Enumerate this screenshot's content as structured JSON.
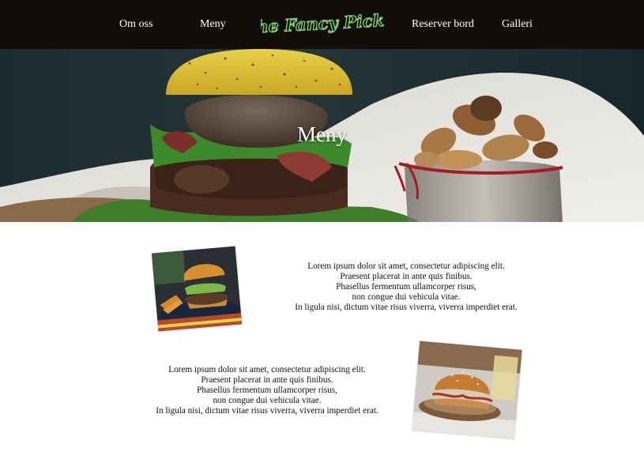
{
  "nav": {
    "links": [
      "Om oss",
      "Meny",
      "Reserver bord",
      "Galleri"
    ],
    "logo_text": "The Fancy Pickle"
  },
  "hero": {
    "title": "Meny"
  },
  "items": [
    {
      "lines": [
        "Lorem ipsum dolor sit amet, consectetur adipiscing elit.",
        "Praesent placerat in ante quis finibus.",
        "Phasellus fermentum ullamcorper risus,",
        "non congue dui vehicula vitae.",
        "In ligula nisi, dictum vitae risus viverra, viverra imperdiet erat."
      ]
    },
    {
      "lines": [
        "Lorem ipsum dolor sit amet, consectetur adipiscing elit.",
        "Praesent placerat in ante quis finibus.",
        "Phasellus fermentum ullamcorper risus,",
        "non congue dui vehicula vitae.",
        "In ligula nisi, dictum vitae risus viverra, viverra imperdiet erat."
      ]
    }
  ],
  "colors": {
    "nav_bg": "#120d0b",
    "logo_green": "#7fd36a",
    "text": "#111111"
  }
}
